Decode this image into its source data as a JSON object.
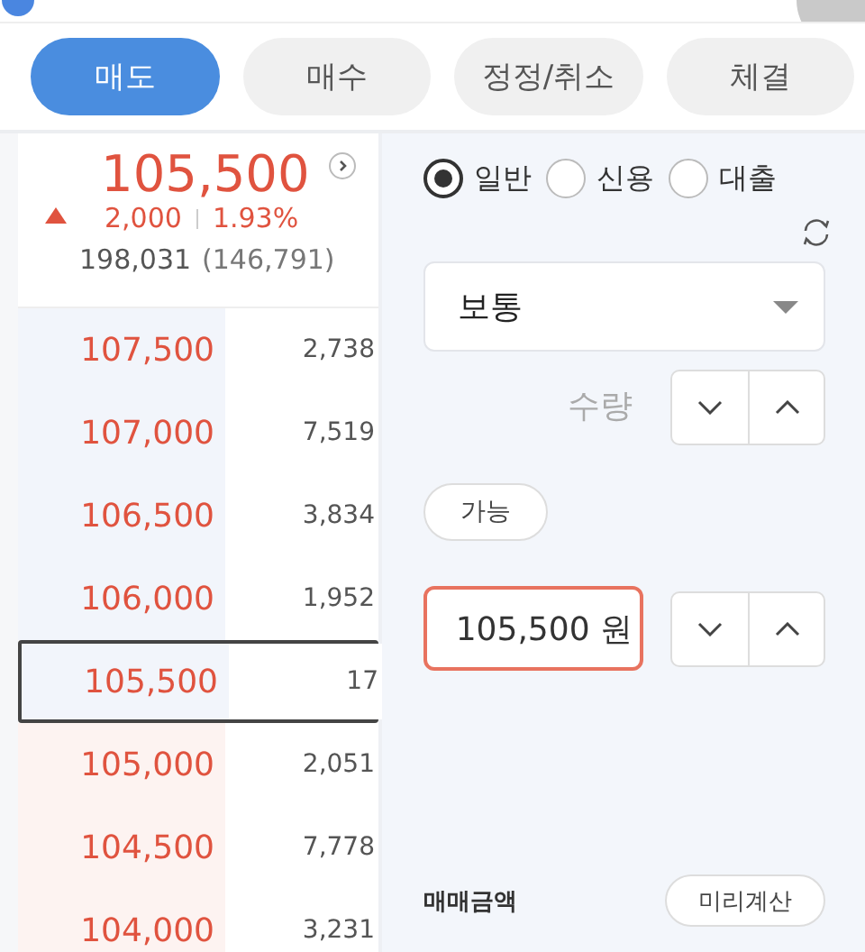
{
  "tabs": [
    {
      "label": "매도",
      "selected": true
    },
    {
      "label": "매수",
      "selected": false
    },
    {
      "label": "정정/취소",
      "selected": false
    },
    {
      "label": "체결",
      "selected": false
    }
  ],
  "quote": {
    "price": "105,500",
    "rising": true,
    "change": "2,000",
    "rate": "1.93%",
    "volume": "198,031",
    "prev_volume": "(146,791)"
  },
  "order_book": [
    {
      "price": "107,500",
      "quantity": "2,738",
      "kind": "ask",
      "selected": false
    },
    {
      "price": "107,000",
      "quantity": "7,519",
      "kind": "ask",
      "selected": false
    },
    {
      "price": "106,500",
      "quantity": "3,834",
      "kind": "ask",
      "selected": false
    },
    {
      "price": "106,000",
      "quantity": "1,952",
      "kind": "ask",
      "selected": false
    },
    {
      "price": "105,500",
      "quantity": "17",
      "kind": "ask",
      "selected": true
    },
    {
      "price": "105,000",
      "quantity": "2,051",
      "kind": "bid",
      "selected": false
    },
    {
      "price": "104,500",
      "quantity": "7,778",
      "kind": "bid",
      "selected": false
    },
    {
      "price": "104,000",
      "quantity": "3,231",
      "kind": "bid",
      "selected": false
    }
  ],
  "account_types": [
    {
      "label": "일반",
      "selected": true
    },
    {
      "label": "신용",
      "selected": false
    },
    {
      "label": "대출",
      "selected": false
    }
  ],
  "order_type": {
    "value": "보통"
  },
  "quantity_field": {
    "placeholder": "수량"
  },
  "available_button": "가능",
  "price_field": {
    "value": "105,500 원",
    "focused": true
  },
  "amount_label": "매매금액",
  "precalc_button": "미리계산"
}
